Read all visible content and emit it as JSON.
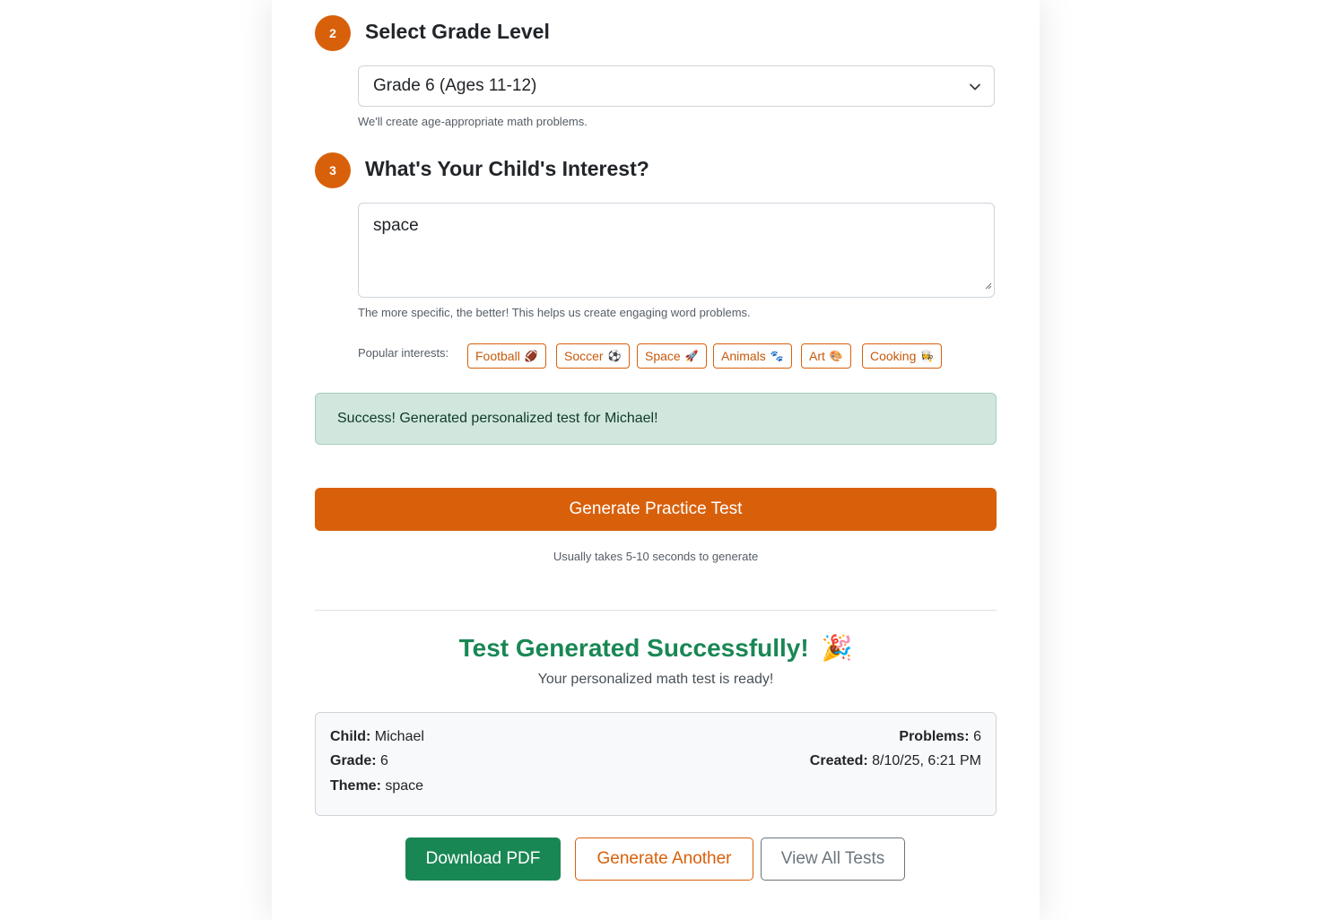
{
  "step2": {
    "number": "2",
    "title": "Select Grade Level",
    "selected_grade": "Grade 6 (Ages 11-12)",
    "help": "We'll create age-appropriate math problems."
  },
  "step3": {
    "number": "3",
    "title": "What's Your Child's Interest?",
    "interest_value": "space",
    "help": "The more specific, the better! This helps us create engaging word problems."
  },
  "popular": {
    "label": "Popular interests:",
    "chips": [
      {
        "label": "Football",
        "emoji": "🏈"
      },
      {
        "label": "Soccer",
        "emoji": "⚽"
      },
      {
        "label": "Space",
        "emoji": "🚀"
      },
      {
        "label": "Animals",
        "emoji": "🐾"
      },
      {
        "label": "Art",
        "emoji": "🎨"
      },
      {
        "label": "Cooking",
        "emoji": "👩‍🍳"
      }
    ]
  },
  "alert": {
    "message": "Success! Generated personalized test for Michael!"
  },
  "generate": {
    "button_label": "Generate Practice Test",
    "note": "Usually takes 5-10 seconds to generate"
  },
  "result": {
    "title": "Test Generated Successfully!",
    "title_emoji": "🎉",
    "subtitle": "Your personalized math test is ready!",
    "child_label": "Child:",
    "child_value": "Michael",
    "grade_label": "Grade:",
    "grade_value": "6",
    "theme_label": "Theme:",
    "theme_value": "space",
    "problems_label": "Problems:",
    "problems_value": "6",
    "created_label": "Created:",
    "created_value": "8/10/25, 6:21 PM"
  },
  "actions": {
    "download_label": "Download PDF",
    "another_label": "Generate Another",
    "view_all_label": "View All Tests"
  },
  "colors": {
    "accent": "#d9600b",
    "success": "#198754",
    "alert_bg": "#d1e7dd"
  }
}
